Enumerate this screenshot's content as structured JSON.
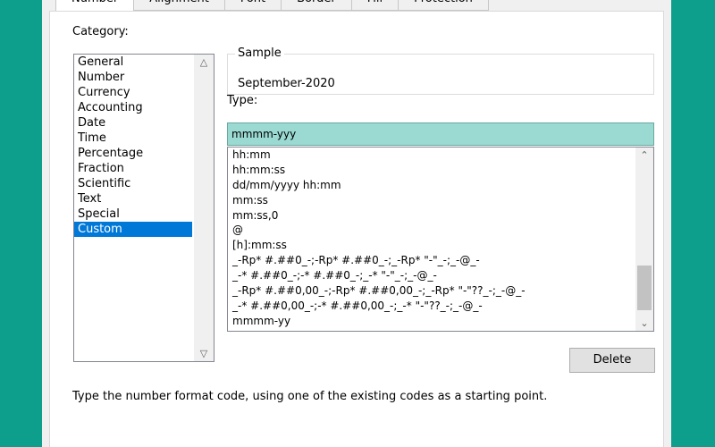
{
  "tabs": [
    "Number",
    "Alignment",
    "Font",
    "Border",
    "Fill",
    "Protection"
  ],
  "category": {
    "label": "Category:",
    "items": [
      "General",
      "Number",
      "Currency",
      "Accounting",
      "Date",
      "Time",
      "Percentage",
      "Fraction",
      "Scientific",
      "Text",
      "Special",
      "Custom"
    ],
    "selected": "Custom"
  },
  "sample": {
    "label": "Sample",
    "value": "September-2020"
  },
  "type": {
    "label": "Type:",
    "value": "mmmm-yyy",
    "codes": [
      "hh:mm",
      "hh:mm:ss",
      "dd/mm/yyyy hh:mm",
      "mm:ss",
      "mm:ss,0",
      "@",
      "[h]:mm:ss",
      "_-Rp* #.##0_-;-Rp* #.##0_-;_-Rp* \"-\"_-;_-@_-",
      "_-* #.##0_-;-* #.##0_-;_-* \"-\"_-;_-@_-",
      "_-Rp* #.##0,00_-;-Rp* #.##0,00_-;_-Rp* \"-\"??_-;_-@_-",
      "_-* #.##0,00_-;-* #.##0,00_-;_-* \"-\"??_-;_-@_-",
      "mmmm-yy"
    ]
  },
  "delete_label": "Delete",
  "hint": "Type the number format code, using one of the existing codes as a starting point.",
  "colors": {
    "background": "#0e9e8c",
    "selection": "#0078d7",
    "type_highlight": "#9adad2"
  }
}
